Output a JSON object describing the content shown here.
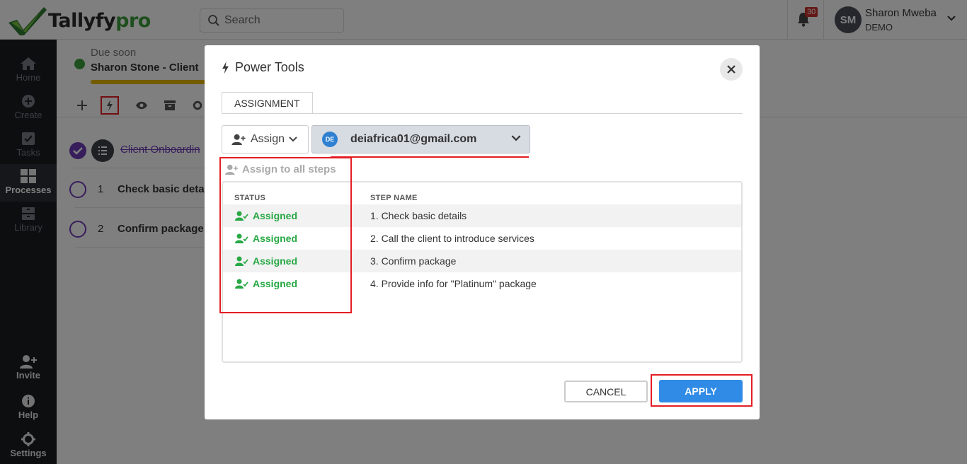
{
  "header": {
    "logo_text": "Tallyfy",
    "logo_suffix": "pro",
    "search_placeholder": "Search",
    "notification_count": "30",
    "user": {
      "initials": "SM",
      "name": "Sharon Mweba",
      "role": "DEMO"
    }
  },
  "sidebar": {
    "items": [
      {
        "label": "Home",
        "icon": "home-icon"
      },
      {
        "label": "Create",
        "icon": "plus-circle-icon"
      },
      {
        "label": "Tasks",
        "icon": "checkbox-icon"
      },
      {
        "label": "Processes",
        "icon": "grid-icon"
      },
      {
        "label": "Library",
        "icon": "archive-icon"
      }
    ],
    "bottom_items": [
      {
        "label": "Invite",
        "icon": "user-plus-icon"
      },
      {
        "label": "Help",
        "icon": "info-icon"
      },
      {
        "label": "Settings",
        "icon": "gear-icon"
      }
    ]
  },
  "process": {
    "due_label": "Due soon",
    "title": "Sharon Stone - Client",
    "rows": [
      {
        "text": "Client Onboardin"
      },
      {
        "num": "1",
        "text": "Check basic deta"
      },
      {
        "num": "2",
        "text": "Confirm package"
      }
    ]
  },
  "modal": {
    "title": "Power Tools",
    "tab": "ASSIGNMENT",
    "assign_label": "Assign",
    "assignee": {
      "initials": "DE",
      "email": "deiafrica01@gmail.com"
    },
    "assign_all": "Assign to all steps",
    "columns": {
      "status": "STATUS",
      "step": "STEP NAME"
    },
    "steps": [
      {
        "status": "Assigned",
        "name": "1. Check basic details"
      },
      {
        "status": "Assigned",
        "name": "2. Call the client to introduce services"
      },
      {
        "status": "Assigned",
        "name": "3. Confirm package"
      },
      {
        "status": "Assigned",
        "name": "4. Provide info for \"Platinum\" package"
      }
    ],
    "cancel_label": "CANCEL",
    "apply_label": "APPLY"
  },
  "colors": {
    "accent": "#2f8be6",
    "assigned": "#27a844",
    "highlight": "#e31e24",
    "brand": "#3c9f3c"
  }
}
